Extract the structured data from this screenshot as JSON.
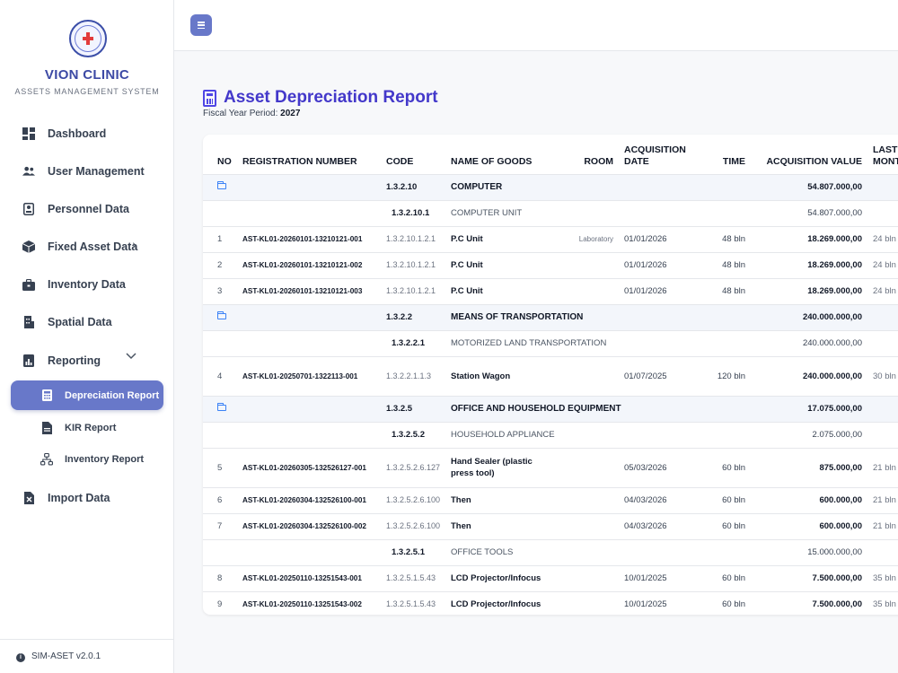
{
  "brand": {
    "name": "VION CLINIC",
    "subtitle": "ASSETS MANAGEMENT SYSTEM"
  },
  "nav": [
    {
      "label": "Dashboard",
      "icon": "dashboard-icon"
    },
    {
      "label": "User Management",
      "icon": "users-icon"
    },
    {
      "label": "Personnel Data",
      "icon": "id-card-icon"
    },
    {
      "label": "Fixed Asset Data",
      "icon": "box-icon",
      "chevron": "›"
    },
    {
      "label": "Inventory Data",
      "icon": "briefcase-icon"
    },
    {
      "label": "Spatial Data",
      "icon": "building-icon"
    },
    {
      "label": "Reporting",
      "icon": "report-icon",
      "chevron": "⌄"
    },
    {
      "label": "Import Data",
      "icon": "excel-file-icon"
    }
  ],
  "reporting_sub": [
    {
      "label": "Depreciation Report",
      "icon": "calculator-icon",
      "active": true
    },
    {
      "label": "KIR Report",
      "icon": "document-icon",
      "active": false
    },
    {
      "label": "Inventory Report",
      "icon": "sitemap-icon",
      "active": false
    }
  ],
  "version": "SIM-ASET v2.0.1",
  "page": {
    "title": "Asset Depreciation Report",
    "fiscal_label": "Fiscal Year Period:",
    "fiscal_year": "2027"
  },
  "table": {
    "headers": {
      "no": "NO",
      "reg": "REGISTRATION NUMBER",
      "code": "CODE",
      "name": "NAME OF GOODS",
      "room": "ROOM",
      "acq_date": "ACQUISITION DATE",
      "time": "TIME",
      "acq_value": "ACQUISITION VALUE",
      "last_month": "LAST MONTH"
    },
    "rows": [
      {
        "type": "group",
        "code": "1.3.2.10",
        "name": "COMPUTER",
        "value": "54.807.000,00"
      },
      {
        "type": "sub",
        "code": "1.3.2.10.1",
        "name": "COMPUTER UNIT",
        "value": "54.807.000,00"
      },
      {
        "type": "item",
        "no": "1",
        "reg": "AST-KL01-20260101-13210121-001",
        "code": "1.3.2.10.1.2.1",
        "name": "P.C Unit",
        "room": "Laboratory",
        "date": "01/01/2026",
        "time": "48 bln",
        "value": "18.269.000,00",
        "last": "24 bln"
      },
      {
        "type": "item",
        "no": "2",
        "reg": "AST-KL01-20260101-13210121-002",
        "code": "1.3.2.10.1.2.1",
        "name": "P.C Unit",
        "room": "",
        "date": "01/01/2026",
        "time": "48 bln",
        "value": "18.269.000,00",
        "last": "24 bln"
      },
      {
        "type": "item",
        "no": "3",
        "reg": "AST-KL01-20260101-13210121-003",
        "code": "1.3.2.10.1.2.1",
        "name": "P.C Unit",
        "room": "",
        "date": "01/01/2026",
        "time": "48 bln",
        "value": "18.269.000,00",
        "last": "24 bln"
      },
      {
        "type": "group",
        "code": "1.3.2.2",
        "name": "MEANS OF TRANSPORTATION",
        "value": "240.000.000,00"
      },
      {
        "type": "sub",
        "code": "1.3.2.2.1",
        "name": "MOTORIZED LAND TRANSPORTATION",
        "value": "240.000.000,00"
      },
      {
        "type": "item",
        "tall": true,
        "no": "4",
        "reg": "AST-KL01-20250701-1322113-001",
        "code": "1.3.2.2.1.1.3",
        "name": "Station Wagon",
        "room": "",
        "date": "01/07/2025",
        "time": "120 bln",
        "value": "240.000.000,00",
        "last": "30 bln"
      },
      {
        "type": "group",
        "code": "1.3.2.5",
        "name": "OFFICE AND HOUSEHOLD EQUIPMENT",
        "value": "17.075.000,00"
      },
      {
        "type": "sub",
        "code": "1.3.2.5.2",
        "name": "HOUSEHOLD APPLIANCE",
        "value": "2.075.000,00"
      },
      {
        "type": "item",
        "tall": true,
        "no": "5",
        "reg": "AST-KL01-20260305-132526127-001",
        "code": "1.3.2.5.2.6.127",
        "name": "Hand Sealer (plastic press tool)",
        "room": "",
        "date": "05/03/2026",
        "time": "60 bln",
        "value": "875.000,00",
        "last": "21 bln"
      },
      {
        "type": "item",
        "no": "6",
        "reg": "AST-KL01-20260304-132526100-001",
        "code": "1.3.2.5.2.6.100",
        "name": "Then",
        "room": "",
        "date": "04/03/2026",
        "time": "60 bln",
        "value": "600.000,00",
        "last": "21 bln"
      },
      {
        "type": "item",
        "no": "7",
        "reg": "AST-KL01-20260304-132526100-002",
        "code": "1.3.2.5.2.6.100",
        "name": "Then",
        "room": "",
        "date": "04/03/2026",
        "time": "60 bln",
        "value": "600.000,00",
        "last": "21 bln"
      },
      {
        "type": "sub",
        "code": "1.3.2.5.1",
        "name": "OFFICE TOOLS",
        "value": "15.000.000,00"
      },
      {
        "type": "item",
        "no": "8",
        "reg": "AST-KL01-20250110-13251543-001",
        "code": "1.3.2.5.1.5.43",
        "name": "LCD Projector/Infocus",
        "room": "",
        "date": "10/01/2025",
        "time": "60 bln",
        "value": "7.500.000,00",
        "last": "35 bln"
      },
      {
        "type": "item",
        "no": "9",
        "reg": "AST-KL01-20250110-13251543-002",
        "code": "1.3.2.5.1.5.43",
        "name": "LCD Projector/Infocus",
        "room": "",
        "date": "10/01/2025",
        "time": "60 bln",
        "value": "7.500.000,00",
        "last": "35 bln"
      }
    ]
  },
  "colors": {
    "accent": "#6878c9",
    "title": "#4338ca",
    "brand": "#3d4aa5",
    "group_row": "#f3f6fb",
    "folder": "#3b82f6"
  }
}
